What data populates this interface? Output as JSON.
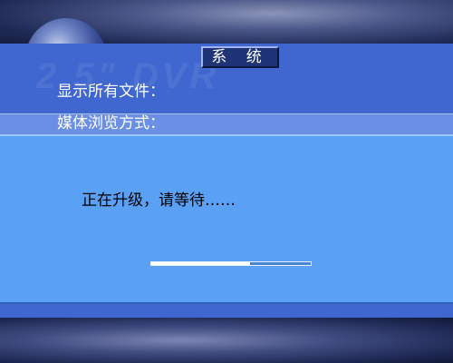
{
  "window": {
    "title": "系 统"
  },
  "menu": {
    "items": [
      {
        "label": "显示所有文件："
      },
      {
        "label": "媒体浏览方式："
      }
    ]
  },
  "dialog": {
    "message": "正在升级，请等待……",
    "progress_fraction": 0.62
  },
  "colors": {
    "panel": "#3f67cf",
    "highlight_row": "#6b8fe4",
    "dialog_bg": "#5aa0f5",
    "title_box": "#1f3377"
  }
}
